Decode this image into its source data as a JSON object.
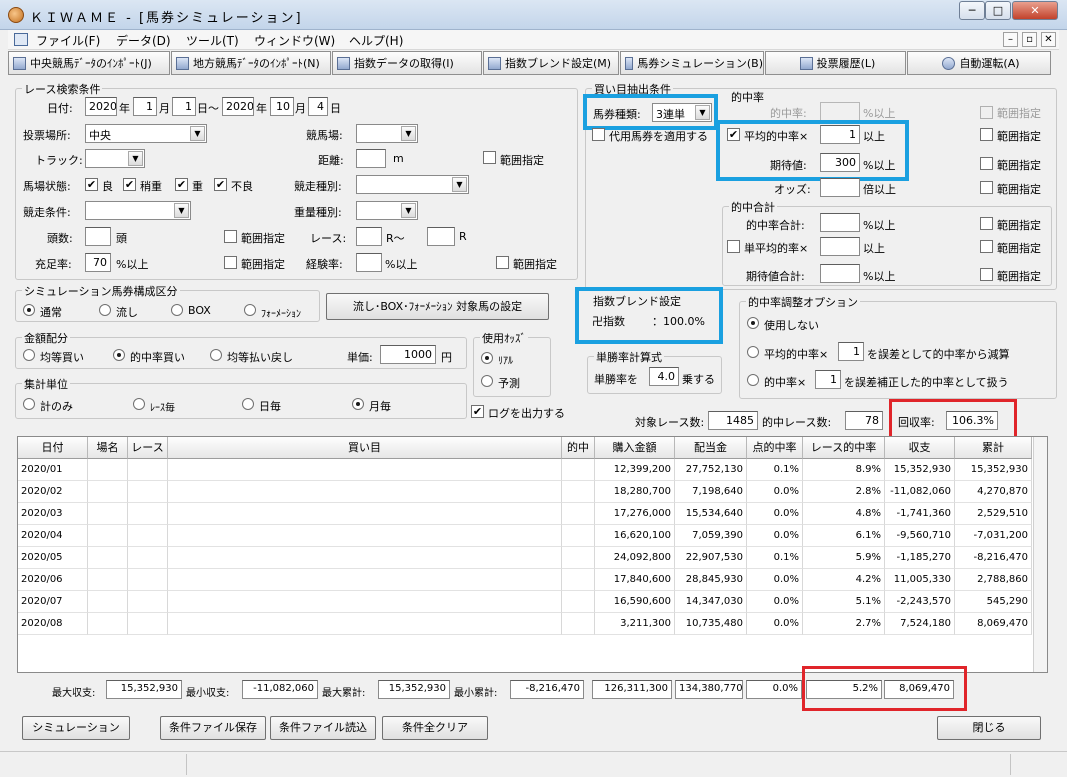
{
  "window": {
    "title": "ＫＩＷＡＭＥ - [馬券シミュレーション]",
    "min": "─",
    "max": "□",
    "close": "✕"
  },
  "menu": [
    "ファイル(F)",
    "データ(D)",
    "ツール(T)",
    "ウィンドウ(W)",
    "ヘルプ(H)"
  ],
  "toolbar": [
    "中央競馬ﾃﾞｰﾀのｲﾝﾎﾟｰﾄ(J)",
    "地方競馬ﾃﾞｰﾀのｲﾝﾎﾟｰﾄ(N)",
    "指数データの取得(I)",
    "指数ブレンド設定(M)",
    "馬券シミュレーション(B)",
    "投票履歴(L)",
    "自動運転(A)"
  ],
  "race_search": {
    "title": "レース検索条件",
    "date_label": "日付:",
    "from_year": "2020",
    "from_month": "1",
    "from_day": "1",
    "to_year": "2020",
    "to_month": "10",
    "to_day": "4",
    "year": "年",
    "month": "月",
    "day": "日",
    "tilde": "日～",
    "venue_label": "投票場所:",
    "venue": "中央",
    "course_label": "競馬場:",
    "track_label": "トラック:",
    "distance_label": "距離:",
    "distance_unit": "m",
    "range": "範囲指定",
    "condition_label": "馬場状態:",
    "cond": [
      "良",
      "稍重",
      "重",
      "不良"
    ],
    "race_type_label": "競走種別:",
    "race_cond_label": "競走条件:",
    "weight_label": "重量種別:",
    "heads_label": "頭数:",
    "heads_unit": "頭",
    "race_label": "レース:",
    "race_r": "R～",
    "race_r2": "R",
    "fill_label": "充足率:",
    "fill_value": "70",
    "fill_unit": "%以上",
    "exp_label": "経験率:",
    "exp_unit": "%以上"
  },
  "bet_extract": {
    "title": "買い目抽出条件",
    "type_label": "馬券種類:",
    "type_value": "3連単",
    "substitute": "代用馬券を適用する",
    "hit_title": "的中率",
    "hit_rate_label": "的中率:",
    "hit_rate_unit": "%以上",
    "avg_hit_label": "平均的中率×",
    "avg_hit_value": "1",
    "avg_hit_unit": "以上",
    "expect_label": "期待値:",
    "expect_value": "300",
    "expect_unit": "%以上",
    "odds_label": "オッズ:",
    "odds_unit": "倍以上",
    "range": "範囲指定",
    "total_title": "的中合計",
    "total_hit_label": "的中率合計:",
    "total_hit_unit": "%以上",
    "single_avg_label": "単平均的率×",
    "single_avg_unit": "以上",
    "expect_total_label": "期待値合計:",
    "expect_total_unit": "%以上"
  },
  "composition": {
    "title": "シミュレーション馬券構成区分",
    "opts": [
      "通常",
      "流し",
      "BOX",
      "ﾌｫｰﾒｰｼｮﾝ"
    ],
    "button": "流し･BOX･ﾌｫｰﾒｰｼｮﾝ 対象馬の設定"
  },
  "blend": {
    "title": "指数ブレンド設定",
    "name": "卍指数",
    "value": "：100.0%"
  },
  "adjust": {
    "title": "的中率調整オプション",
    "o1": "使用しない",
    "o2a": "平均的中率×",
    "o2v": "1",
    "o2b": "を誤差として的中率から減算",
    "o3a": "的中率×",
    "o3v": "1",
    "o3b": "を誤差補正した的中率として扱う"
  },
  "money": {
    "title": "金額配分",
    "opts": [
      "均等買い",
      "的中率買い",
      "均等払い戻し"
    ],
    "unit_label": "単価:",
    "unit_value": "1000",
    "yen": "円"
  },
  "odds_use": {
    "title": "使用ｵｯｽﾞ",
    "opts": [
      "ﾘｱﾙ",
      "予測"
    ]
  },
  "single_rate": {
    "title": "単勝率計算式",
    "a": "単勝率を",
    "v": "4.0",
    "b": "乗する"
  },
  "summary_unit": {
    "title": "集計単位",
    "opts": [
      "計のみ",
      "ﾚｰｽ毎",
      "日毎",
      "月毎"
    ]
  },
  "log": "ログを出力する",
  "stats": {
    "target_label": "対象レース数:",
    "target": "1485",
    "hit_label": "的中レース数:",
    "hit": "78",
    "return_label": "回収率:",
    "return": "106.3%"
  },
  "table": {
    "headers": [
      "日付",
      "場名",
      "レース",
      "買い目",
      "的中",
      "購入金額",
      "配当金",
      "点的中率",
      "レース的中率",
      "収支",
      "累計"
    ],
    "rows": [
      [
        "2020/01",
        "",
        "",
        "",
        "",
        "12,399,200",
        "27,752,130",
        "0.1%",
        "8.9%",
        "15,352,930",
        "15,352,930"
      ],
      [
        "2020/02",
        "",
        "",
        "",
        "",
        "18,280,700",
        "7,198,640",
        "0.0%",
        "2.8%",
        "-11,082,060",
        "4,270,870"
      ],
      [
        "2020/03",
        "",
        "",
        "",
        "",
        "17,276,000",
        "15,534,640",
        "0.0%",
        "4.8%",
        "-1,741,360",
        "2,529,510"
      ],
      [
        "2020/04",
        "",
        "",
        "",
        "",
        "16,620,100",
        "7,059,390",
        "0.0%",
        "6.1%",
        "-9,560,710",
        "-7,031,200"
      ],
      [
        "2020/05",
        "",
        "",
        "",
        "",
        "24,092,800",
        "22,907,530",
        "0.1%",
        "5.9%",
        "-1,185,270",
        "-8,216,470"
      ],
      [
        "2020/06",
        "",
        "",
        "",
        "",
        "17,840,600",
        "28,845,930",
        "0.0%",
        "4.2%",
        "11,005,330",
        "2,788,860"
      ],
      [
        "2020/07",
        "",
        "",
        "",
        "",
        "16,590,600",
        "14,347,030",
        "0.0%",
        "5.1%",
        "-2,243,570",
        "545,290"
      ],
      [
        "2020/08",
        "",
        "",
        "",
        "",
        "3,211,300",
        "10,735,480",
        "0.0%",
        "2.7%",
        "7,524,180",
        "8,069,470"
      ]
    ]
  },
  "footer": {
    "max_label": "最大収支:",
    "max": "15,352,930",
    "min_label": "最小収支:",
    "min": "-11,082,060",
    "maxc_label": "最大累計:",
    "maxc": "15,352,930",
    "minc_label": "最小累計:",
    "minc": "-8,216,470",
    "buy": "126,311,300",
    "pay": "134,380,770",
    "point": "0.0%",
    "race": "5.2%",
    "total": "8,069,470"
  },
  "buttons": {
    "sim": "シミュレーション",
    "save": "条件ファイル保存",
    "load": "条件ファイル読込",
    "clear": "条件全クリア",
    "close": "閉じる"
  }
}
